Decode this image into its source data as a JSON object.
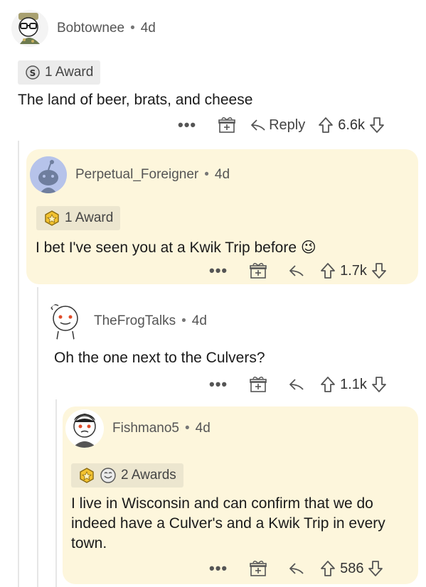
{
  "comments": [
    {
      "username": "Bobtownee",
      "separator": "•",
      "age": "4d",
      "award_text": "1 Award",
      "body": "The land of beer, brats, and cheese",
      "more": "•••",
      "reply_label": "Reply",
      "votes": "6.6k"
    },
    {
      "username": "Perpetual_Foreigner",
      "separator": "•",
      "age": "4d",
      "award_text": "1 Award",
      "body": "I bet I've seen you at a Kwik Trip before",
      "emoji": "😉",
      "more": "•••",
      "votes": "1.7k"
    },
    {
      "username": "TheFrogTalks",
      "separator": "•",
      "age": "4d",
      "body": "Oh the one next to the Culvers?",
      "more": "•••",
      "votes": "1.1k"
    },
    {
      "username": "Fishmano5",
      "separator": "•",
      "age": "4d",
      "award_text": "2 Awards",
      "body": "I live in Wisconsin and can confirm that we do indeed have a Culver's and a Kwik Trip in every town.",
      "more": "•••",
      "votes": "586"
    }
  ],
  "colors": {
    "highlight": "#fdf6dc",
    "thread_line": "#e6e6e6",
    "text": "#1c1c1c"
  }
}
